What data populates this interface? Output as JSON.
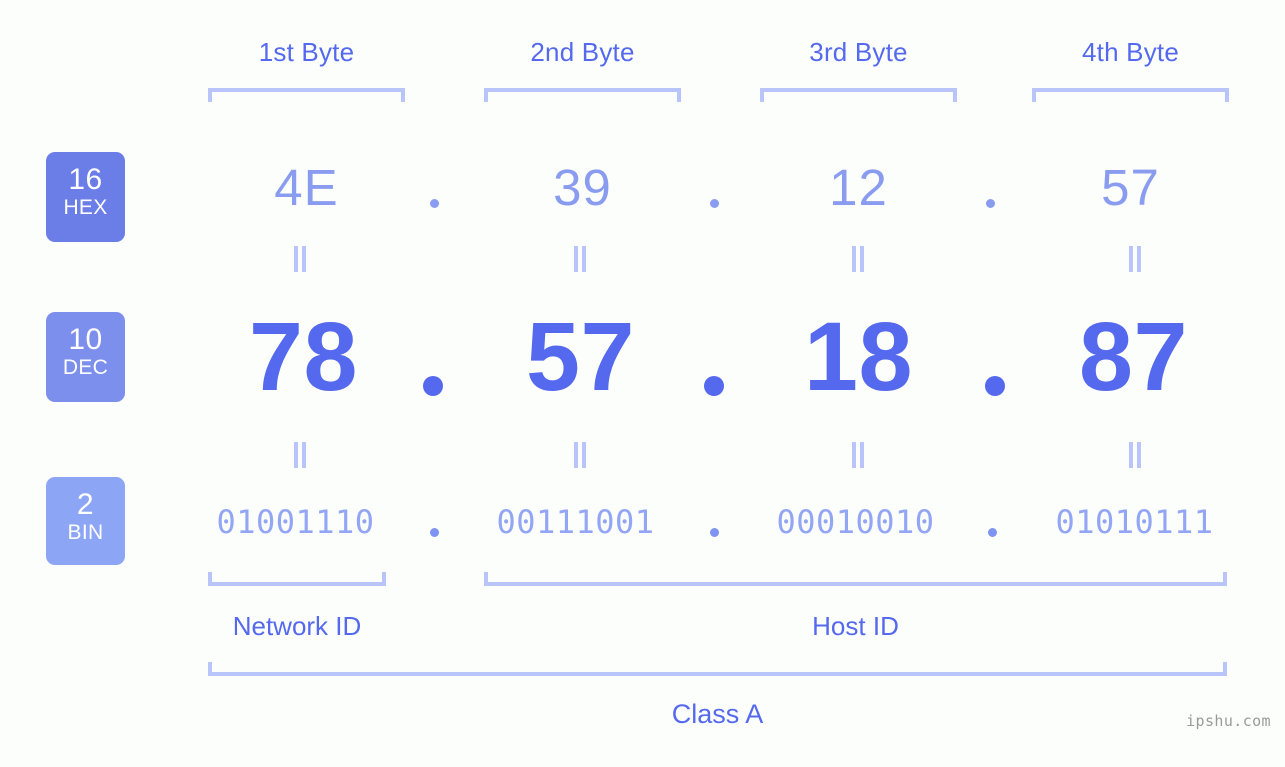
{
  "background_color": "#fcfefb",
  "accent_color": "#5569ee",
  "bracket_color": "#b9c4fb",
  "header": {
    "bytes": [
      {
        "label": "1st Byte"
      },
      {
        "label": "2nd Byte"
      },
      {
        "label": "3rd Byte"
      },
      {
        "label": "4th Byte"
      }
    ]
  },
  "rows": {
    "hex": {
      "badge_number": "16",
      "badge_name": "HEX",
      "badge_color": "#6b7ee8",
      "value_color": "#8a9cf0",
      "values": [
        "4E",
        "39",
        "12",
        "57"
      ],
      "separator": "."
    },
    "dec": {
      "badge_number": "10",
      "badge_name": "DEC",
      "badge_color": "#7d8fed",
      "value_color": "#5569ee",
      "values": [
        "78",
        "57",
        "18",
        "87"
      ],
      "separator": "."
    },
    "bin": {
      "badge_number": "2",
      "badge_name": "BIN",
      "badge_color": "#8ca5f5",
      "value_color": "#93a6f5",
      "values": [
        "01001110",
        "00111001",
        "00010010",
        "01010111"
      ],
      "separator": "."
    }
  },
  "equality_symbol": "=",
  "sections": {
    "network_id": "Network ID",
    "host_id": "Host ID",
    "class": "Class A"
  },
  "watermark": "ipshu.com"
}
